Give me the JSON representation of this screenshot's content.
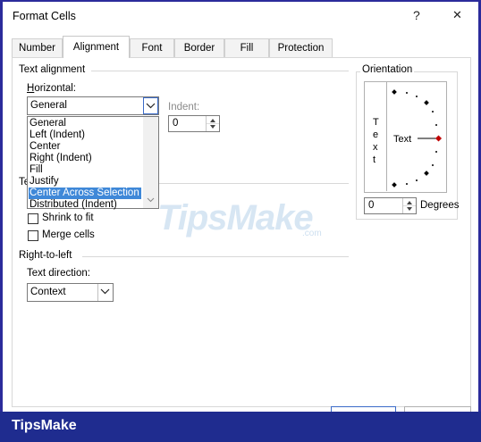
{
  "window": {
    "title": "Format Cells",
    "help_glyph": "?",
    "close_glyph": "✕"
  },
  "tabs": [
    {
      "label": "Number"
    },
    {
      "label": "Alignment"
    },
    {
      "label": "Font"
    },
    {
      "label": "Border"
    },
    {
      "label": "Fill"
    },
    {
      "label": "Protection"
    }
  ],
  "active_tab": "Alignment",
  "text_alignment": {
    "group_label": "Text alignment",
    "horizontal_label": "Horizontal:",
    "horizontal_value": "General",
    "horizontal_options": [
      "General",
      "Left (Indent)",
      "Center",
      "Right (Indent)",
      "Fill",
      "Justify",
      "Center Across Selection",
      "Distributed (Indent)"
    ],
    "highlighted_option": "Center Across Selection",
    "indent_label": "Indent:",
    "indent_value": "0"
  },
  "text_control": {
    "group_label_fragment": "Te",
    "shrink_to_fit": "Shrink to fit",
    "merge_cells": "Merge cells"
  },
  "right_to_left": {
    "group_label": "Right-to-left",
    "direction_label": "Text direction:",
    "direction_value": "Context"
  },
  "orientation": {
    "group_label": "Orientation",
    "vertical_text": [
      "T",
      "e",
      "x",
      "t"
    ],
    "dial_label": "Text",
    "degrees_value": "0",
    "degrees_label": "Degrees"
  },
  "watermark": {
    "brand": "TipsMake",
    "suffix": ".com"
  },
  "footer": {
    "brand": "TipsMake"
  },
  "colors": {
    "selection": "#3f88d8",
    "footer": "#1f2c8f",
    "accent_red": "#c00000"
  }
}
